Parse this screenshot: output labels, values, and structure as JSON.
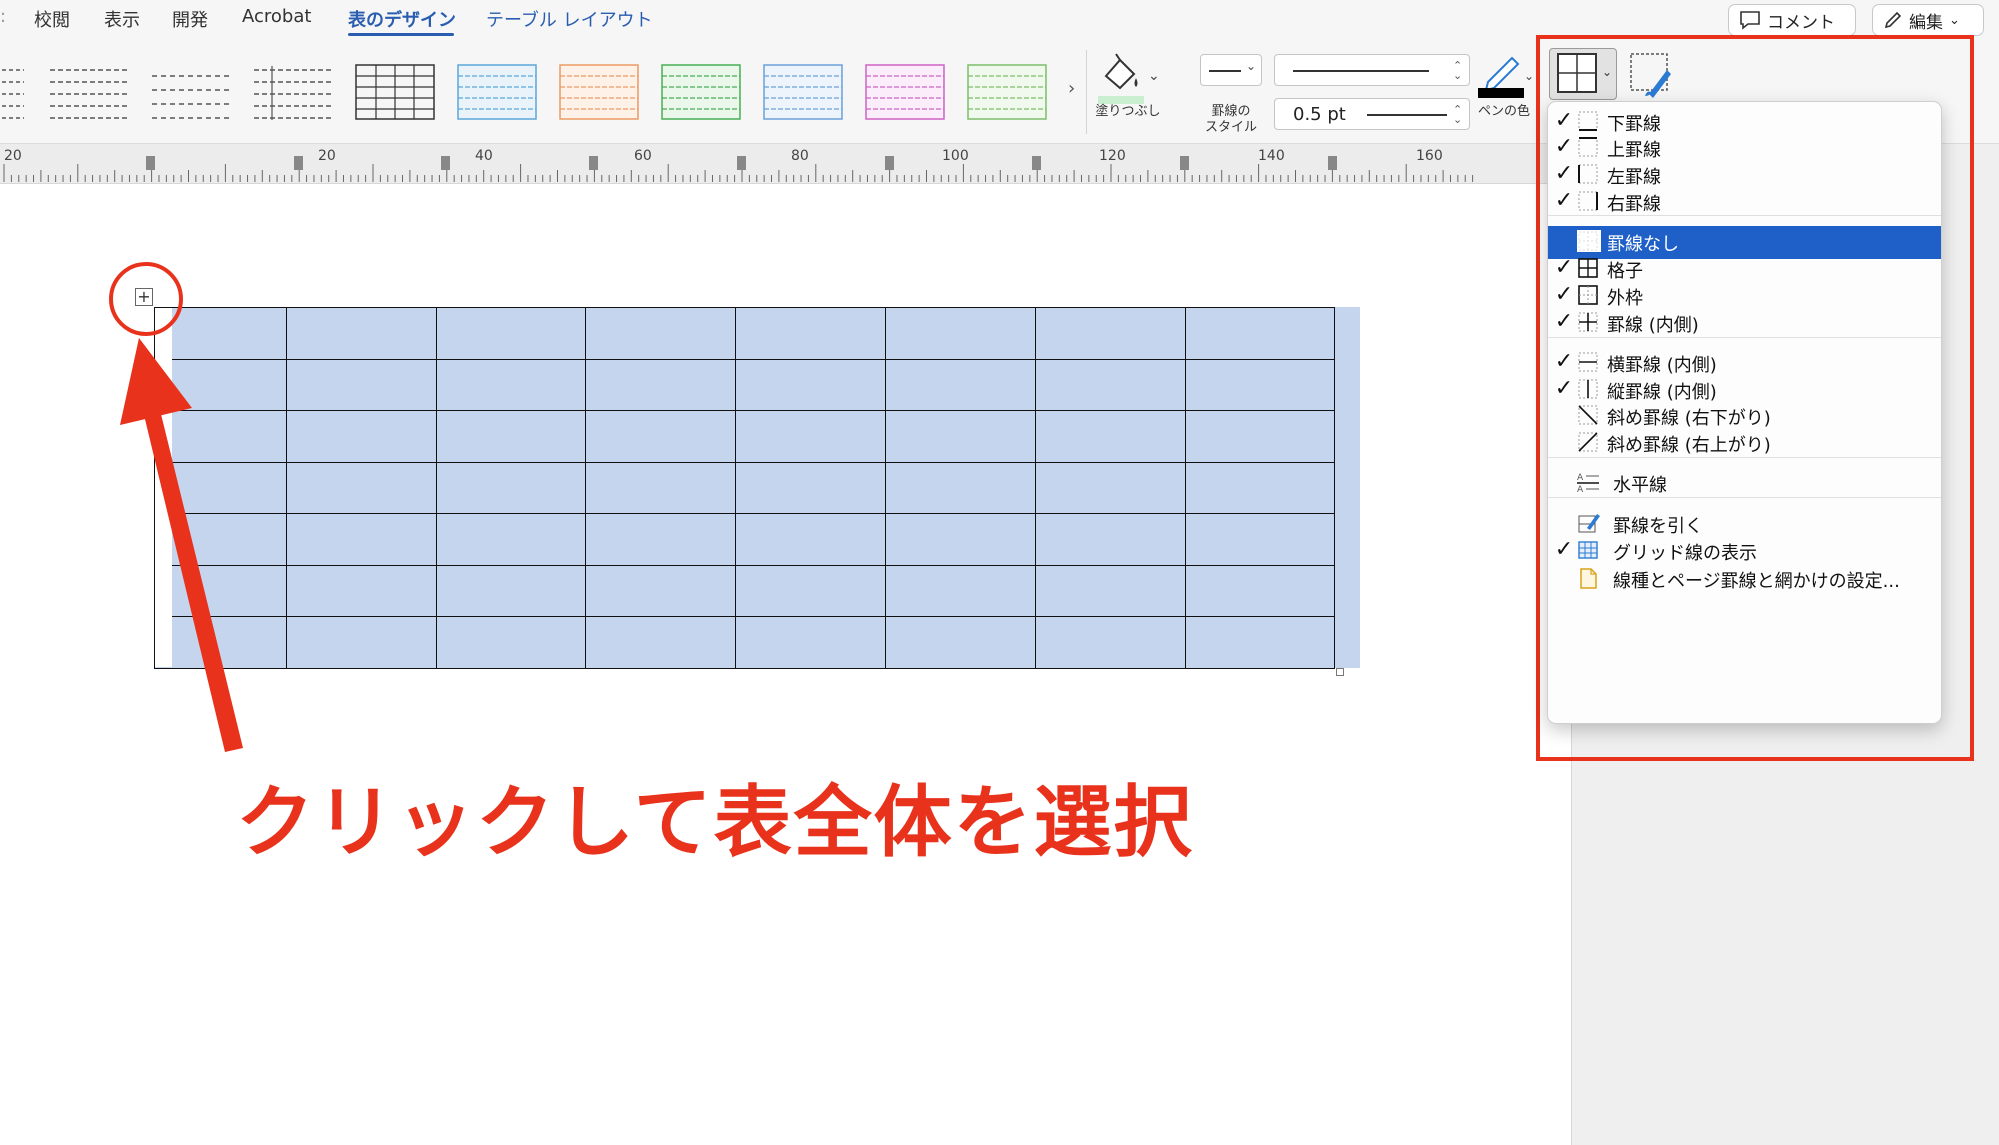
{
  "menu_tabs": {
    "review": "校閲",
    "view": "表示",
    "developer": "開発",
    "acrobat": "Acrobat",
    "table_design": "表のデザイン",
    "table_layout": "テーブル レイアウト"
  },
  "top_buttons": {
    "comment": "コメント",
    "edit": "編集"
  },
  "ribbon": {
    "shading_label": "塗りつぶし",
    "border_style_label_1": "罫線の",
    "border_style_label_2": "スタイル",
    "pen_weight": "0.5 pt",
    "pen_color_label": "ペンの色",
    "pen_color": "#000000"
  },
  "ruler": {
    "numbers": [
      "20",
      "20",
      "40",
      "60",
      "80",
      "100",
      "120",
      "140",
      "160"
    ]
  },
  "border_menu": {
    "items": [
      {
        "label": "下罫線",
        "checked": true,
        "icon": "bottom-border-icon"
      },
      {
        "label": "上罫線",
        "checked": true,
        "icon": "top-border-icon"
      },
      {
        "label": "左罫線",
        "checked": true,
        "icon": "left-border-icon"
      },
      {
        "label": "右罫線",
        "checked": true,
        "icon": "right-border-icon"
      },
      {
        "label": "罫線なし",
        "checked": false,
        "icon": "no-border-icon",
        "highlighted": true
      },
      {
        "label": "格子",
        "checked": true,
        "icon": "all-borders-icon"
      },
      {
        "label": "外枠",
        "checked": true,
        "icon": "outside-borders-icon"
      },
      {
        "label": "罫線 (内側)",
        "checked": true,
        "icon": "inside-borders-icon"
      },
      {
        "label": "横罫線 (内側)",
        "checked": true,
        "icon": "inside-horizontal-border-icon"
      },
      {
        "label": "縦罫線 (内側)",
        "checked": true,
        "icon": "inside-vertical-border-icon"
      },
      {
        "label": "斜め罫線 (右下がり)",
        "checked": false,
        "icon": "diagonal-down-border-icon"
      },
      {
        "label": "斜め罫線 (右上がり)",
        "checked": false,
        "icon": "diagonal-up-border-icon"
      },
      {
        "label": "水平線",
        "checked": false,
        "icon": "horizontal-line-icon"
      },
      {
        "label": "罫線を引く",
        "checked": false,
        "icon": "draw-table-icon"
      },
      {
        "label": "グリッド線の表示",
        "checked": true,
        "icon": "view-gridlines-icon"
      },
      {
        "label": "線種とページ罫線と網かけの設定...",
        "checked": false,
        "icon": "borders-shading-icon"
      }
    ],
    "checkmark": "✓"
  },
  "annotation": {
    "callout_text": "クリックして表全体を選択",
    "color": "#e8321c"
  },
  "table": {
    "rows": 7,
    "cols": 8,
    "fill": "#c6d5ee"
  }
}
